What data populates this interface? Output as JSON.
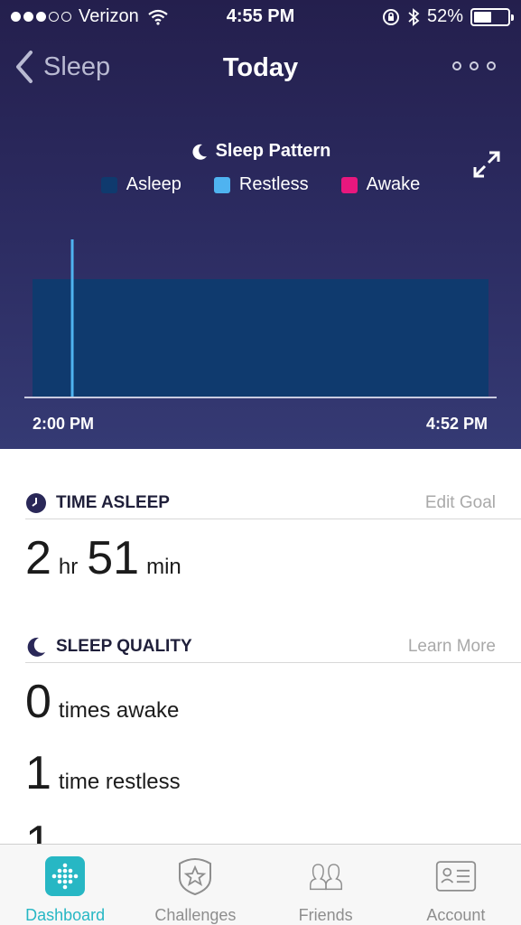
{
  "status_bar": {
    "carrier": "Verizon",
    "time": "4:55 PM",
    "battery": "52%",
    "battery_fraction": 0.52,
    "signal_bars_filled": 3,
    "signal_bars_total": 5
  },
  "nav": {
    "back_label": "Sleep",
    "title": "Today"
  },
  "chart_header": {
    "title": "Sleep Pattern"
  },
  "legend": [
    {
      "label": "Asleep",
      "color": "#0f3a6e"
    },
    {
      "label": "Restless",
      "color": "#4fb3f0"
    },
    {
      "label": "Awake",
      "color": "#e8177e"
    }
  ],
  "chart_data": {
    "type": "area",
    "x_start": "2:00 PM",
    "x_end": "4:52 PM",
    "segments": [
      {
        "state": "Asleep",
        "start": "2:00 PM",
        "end": "4:52 PM"
      }
    ],
    "events": [
      {
        "state": "Restless",
        "time": "2:15 PM"
      }
    ],
    "tick_labels": [
      "2:00 PM",
      "4:52 PM"
    ]
  },
  "time_asleep": {
    "title": "TIME ASLEEP",
    "link": "Edit Goal",
    "hours": "2",
    "hours_unit": "hr",
    "minutes": "51",
    "minutes_unit": "min"
  },
  "sleep_quality": {
    "title": "SLEEP QUALITY",
    "link": "Learn More",
    "rows": [
      {
        "value": "0",
        "label": "times awake"
      },
      {
        "value": "1",
        "label": "time restless"
      },
      {
        "value": "1",
        "label": ""
      }
    ]
  },
  "tabs": [
    {
      "label": "Dashboard",
      "icon": "dashboard-icon",
      "active": true
    },
    {
      "label": "Challenges",
      "icon": "challenges-icon",
      "active": false
    },
    {
      "label": "Friends",
      "icon": "friends-icon",
      "active": false
    },
    {
      "label": "Account",
      "icon": "account-icon",
      "active": false
    }
  ],
  "colors": {
    "accent": "#27b7c4",
    "hero_top": "#241f4d",
    "hero_bottom": "#353a74"
  }
}
